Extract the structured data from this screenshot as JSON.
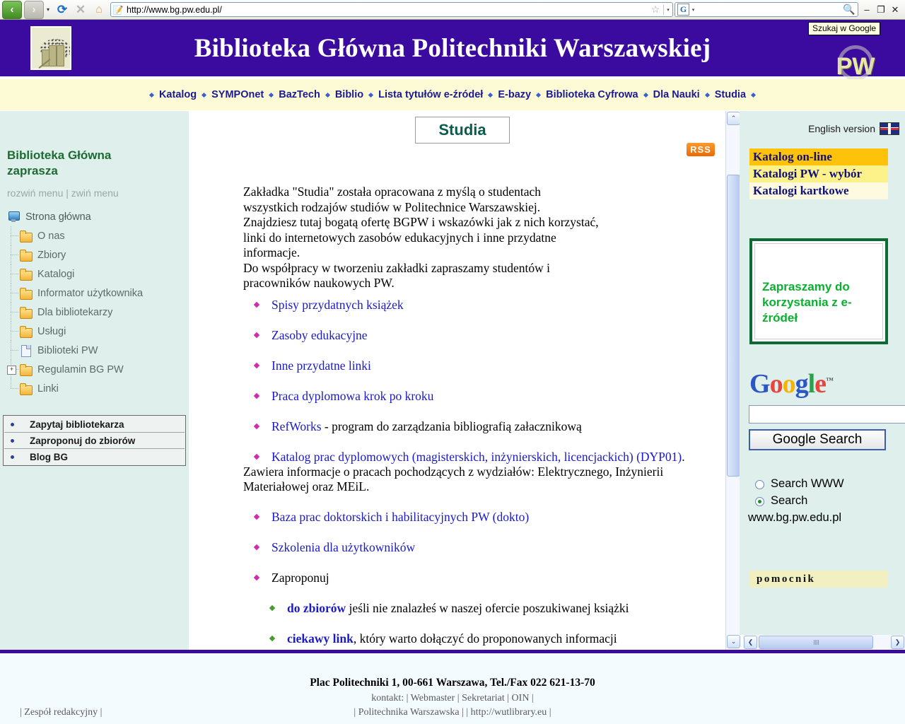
{
  "browser": {
    "url": "http://www.bg.pw.edu.pl/",
    "back_icon": "‹",
    "forward_icon": "›",
    "reload_icon": "⟳",
    "stop_icon": "✕",
    "home_icon": "⌂",
    "favicon": "📝",
    "star_icon": "☆",
    "caret_icon": "▾",
    "google_letter": "G",
    "magnify_icon": "🔍",
    "search_value": "",
    "minimize": "–",
    "restore": "❐",
    "close": "✕",
    "tooltip": "Szukaj w Google"
  },
  "header": {
    "title": "Biblioteka Główna Politechniki Warszawskiej",
    "pw_logo_text": "PW",
    "banner_color": "#3b0ba0"
  },
  "topmenu": {
    "items": [
      "Katalog",
      "SYMPOnet",
      "BazTech",
      "Biblio",
      "Lista tytułów e-źródeł",
      "E-bazy",
      "Biblioteka Cyfrowa",
      "Dla Nauki",
      "Studia"
    ]
  },
  "left": {
    "title": "Biblioteka Główna zaprasza",
    "expand": "rozwiń menu",
    "separator": "|",
    "collapse": "zwiń menu",
    "tree": [
      {
        "label": "Strona główna",
        "icon": "computer-icon",
        "level": 0,
        "expander": ""
      },
      {
        "label": "O nas",
        "icon": "folder-icon",
        "level": 1,
        "expander": ""
      },
      {
        "label": "Zbiory",
        "icon": "folder-icon",
        "level": 1,
        "expander": ""
      },
      {
        "label": "Katalogi",
        "icon": "folder-icon",
        "level": 1,
        "expander": ""
      },
      {
        "label": "Informator użytkownika",
        "icon": "folder-icon",
        "level": 1,
        "expander": ""
      },
      {
        "label": "Dla bibliotekarzy",
        "icon": "folder-icon",
        "level": 1,
        "expander": ""
      },
      {
        "label": "Usługi",
        "icon": "folder-icon",
        "level": 1,
        "expander": ""
      },
      {
        "label": "Biblioteki PW",
        "icon": "document-icon",
        "level": 1,
        "expander": ""
      },
      {
        "label": "Regulamin BG PW",
        "icon": "folder-icon",
        "level": 1,
        "expander": "+"
      },
      {
        "label": "Linki",
        "icon": "folder-icon",
        "level": 1,
        "expander": ""
      }
    ],
    "boxlinks": [
      "Zapytaj bibliotekarza",
      "Zaproponuj do zbiorów",
      "Blog BG"
    ]
  },
  "main": {
    "page_title": "Studia",
    "rss_label": "RSS",
    "intro": "Zakładka \"Studia\" została opracowana z myślą o studentach wszystkich rodzajów studiów w Politechnice Warszawskiej. Znajdziesz tutaj bogatą ofertę BGPW i wskazówki jak z nich korzystać, linki do internetowych zasobów edukacyjnych i inne przydatne informacje. Do współpracy w tworzeniu zakładki zapraszamy studentów i pracowników naukowych PW.",
    "intro_lines": [
      "Zakładka \"Studia\" została opracowana z myślą o studentach",
      "wszystkich rodzajów studiów w Politechnice Warszawskiej.",
      "Znajdziesz tutaj bogatą ofertę BGPW i wskazówki jak z nich korzystać,",
      "linki do internetowych zasobów edukacyjnych i inne przydatne",
      "informacje.",
      "Do współpracy w tworzeniu zakładki zapraszamy studentów i",
      "pracowników naukowych PW."
    ],
    "links": [
      {
        "link": "Spisy przydatnych książek",
        "rest": ""
      },
      {
        "link": "Zasoby edukacyjne",
        "rest": ""
      },
      {
        "link": "Inne przydatne linki",
        "rest": ""
      },
      {
        "link": "Praca dyplomowa krok po kroku",
        "rest": ""
      },
      {
        "link": "RefWorks",
        "rest": " - program do zarządzania bibliografią załacznikową"
      },
      {
        "link": "Katalog prac dyplomowych (magisterskich, inżynierskich, licencjackich) (DYP01)",
        "rest": ". Zawiera informacje o pracach pochodzących z wydziałów: Elektrycznego, Inżynierii Materiałowej oraz MEiL."
      },
      {
        "link": "Baza prac doktorskich i habilitacyjnych PW (dokto)",
        "rest": ""
      },
      {
        "link": "Szkolenia dla użytkowników",
        "rest": ""
      }
    ],
    "propose_label": "Zaproponuj",
    "sublinks": [
      {
        "link": "do zbiorów",
        "rest": " jeśli nie znalazłeś w naszej ofercie poszukiwanej książki"
      },
      {
        "link": "ciekawy link",
        "rest": ", który warto dołączyć do proponowanych informacji"
      }
    ]
  },
  "right": {
    "english_version": "English version",
    "flag": "uk-flag-icon",
    "catalogs": [
      {
        "label": "Katalog on-line",
        "color": "#ffc20a"
      },
      {
        "label": "Katalogi PW - wybór",
        "color": "#fdf28a"
      },
      {
        "label": "Katalogi kartkowe",
        "color": "#fdfae0"
      }
    ],
    "promo": "Zapraszamy do korzystania z e-źródeł",
    "google": {
      "logo_letters": [
        "G",
        "o",
        "o",
        "g",
        "l",
        "e"
      ],
      "trademark": "™",
      "input_value": "",
      "button_label": "Google Search",
      "options": [
        {
          "label": "Search WWW",
          "selected": false
        },
        {
          "label": "Search www.bg.pw.edu.pl",
          "selected": true
        }
      ],
      "option1": "Search WWW",
      "option2_line1": "Search",
      "option2_line2": "www.bg.pw.edu.pl"
    },
    "pomocnik": "pomocnik"
  },
  "footer": {
    "address": "Plac Politechniki 1, 00-661 Warszawa, Tel./Fax 022 621-13-70",
    "contact_line": "kontakt: | Webmaster | Sekretariat | OIN |",
    "links_line": "| Politechnika Warszawska | | http://wutlibrary.eu |",
    "editors": "| Zespół redakcyjny |"
  },
  "scrollbars": {
    "up_arrow": "⌃",
    "down_arrow": "⌄",
    "left_arrow": "❮",
    "right_arrow": "❯"
  }
}
